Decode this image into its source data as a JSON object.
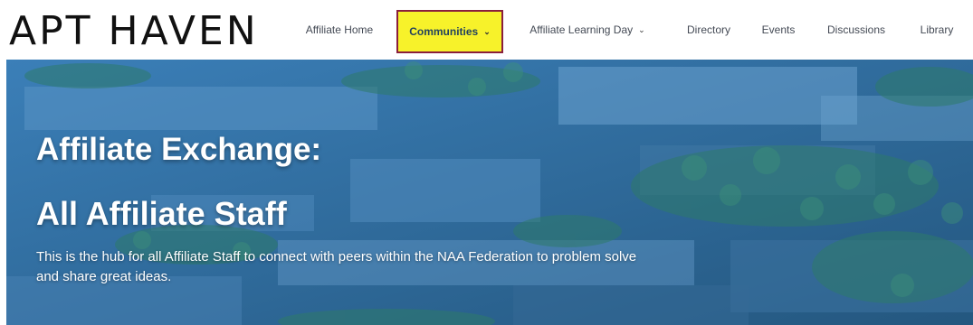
{
  "brand": {
    "logo_text": "APT HAVEN"
  },
  "nav": {
    "items": [
      {
        "label": "Affiliate Home",
        "dropdown": false
      },
      {
        "label": "Communities",
        "dropdown": true,
        "highlighted": true
      },
      {
        "label": "Affiliate Learning Day",
        "dropdown": true
      },
      {
        "label": "Directory",
        "dropdown": false
      },
      {
        "label": "Events",
        "dropdown": false
      },
      {
        "label": "Discussions",
        "dropdown": false
      },
      {
        "label": "Library",
        "dropdown": false
      }
    ],
    "chevron_icon": "chevron-down-icon"
  },
  "hero": {
    "title_line1": "Affiliate Exchange:",
    "title_line2": "All Affiliate Staff",
    "description": "This is the hub for all Affiliate Staff to connect with peers within the NAA Federation to problem solve and share great ideas."
  },
  "colors": {
    "highlight_fill": "#f7f22a",
    "highlight_border": "#8a1f3c",
    "hero_overlay": "#2f6ea5",
    "nav_text": "#444a55"
  }
}
